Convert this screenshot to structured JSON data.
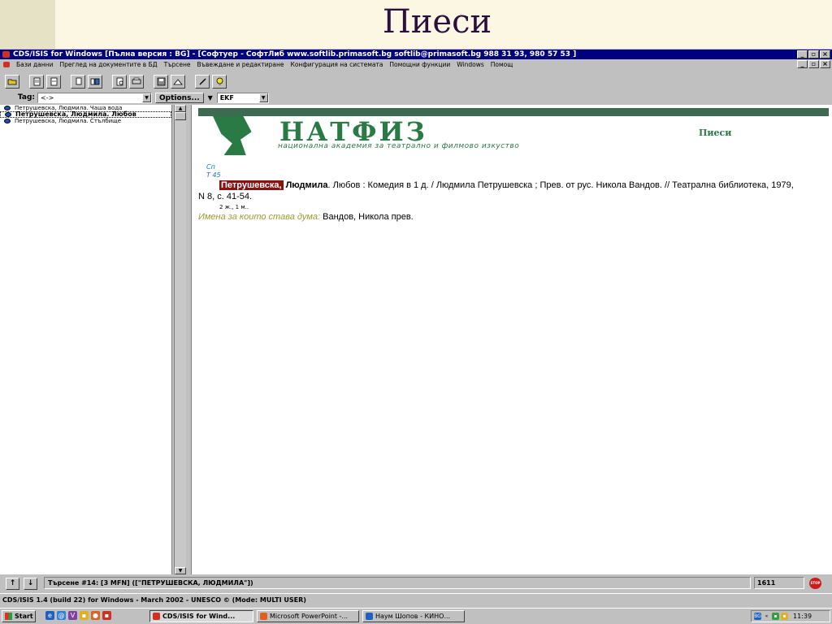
{
  "slide": {
    "title": "Пиеси"
  },
  "window": {
    "title": "CDS/ISIS for Windows [Пълна версия : BG] - [Софтуер - СофтЛиб www.softlib.primasoft.bg softlib@primasoft.bg 988 31 93, 980 57 53 ]",
    "controls": [
      "_",
      "▫",
      "×"
    ]
  },
  "menu": [
    "Бази данни",
    "Преглед на документите в БД",
    "Търсене",
    "Въвеждане и редактиране",
    "Конфигурация на системата",
    "Помощни функции",
    "Windows",
    "Помощ"
  ],
  "tagbar": {
    "tag_label": "Tag:",
    "tag_value": "<->",
    "options_label": "Options...",
    "format_value": "EKF"
  },
  "list": [
    {
      "text": "Петрушевска, Людмила. Чаша вода",
      "active": false
    },
    {
      "text": "Петрушевска, Людмила. Любов",
      "active": true
    },
    {
      "text": "Петрушевска, Людмила. Стълбище",
      "active": false
    }
  ],
  "record": {
    "header_caption": "Пиеси",
    "logo_text": "НАТФИЗ",
    "logo_subtitle": "национална академия за театрално и филмово изкуство",
    "sig1": "Сп",
    "sig2": "Т 45",
    "author_highlight": "Петрушевска,",
    "author_rest": " Людмила",
    "body": ". Любов : Комедия в 1 д. / Людмила Петрушевска ; Прев. от рус. Никола Вандов. // Театрална библиотека, 1979, N 8, с. 41-54.",
    "note": "2 ж., 1 м..",
    "persons_label": "Имена за които става дума:",
    "persons_value": " Вандов, Никола прев."
  },
  "status": {
    "query": "Търсене #14: [3 MFN] ([\"ПЕТРУШЕВСКА, ЛЮДМИЛА\"])",
    "count": "1611",
    "stop_label": "STOP"
  },
  "info": "CDS/ISIS 1.4 (build 22) for Windows - March 2002 - UNESCO © (Mode: MULTI USER)",
  "taskbar": {
    "start": "Start",
    "tasks": [
      "CDS/ISIS for Wind...",
      "Microsoft PowerPoint -...",
      "Наум Шопов - КИНО..."
    ],
    "clock": "11:39"
  },
  "colors": {
    "slide_title": "#2b0f3f",
    "natfiz_green": "#2a7a46",
    "titlebar": "#000080",
    "highlight": "#8b1010"
  }
}
